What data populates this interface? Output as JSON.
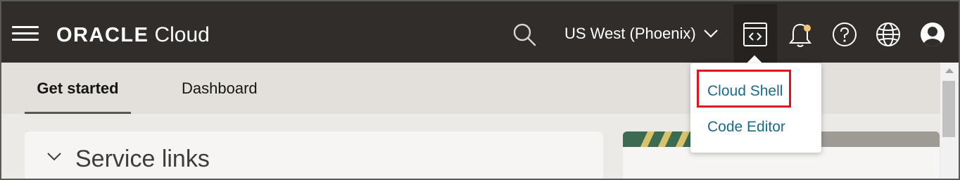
{
  "header": {
    "brand_oracle": "ORACLE",
    "brand_cloud": "Cloud",
    "region": "US West (Phoenix)",
    "icons": [
      "menu-icon",
      "search-icon",
      "chevron-down-icon",
      "code-icon",
      "bell-icon",
      "help-icon",
      "globe-icon",
      "user-icon"
    ],
    "colors": {
      "bar": "#312d2a",
      "active_button": "#252220",
      "notification_dot": "#f5c27a"
    }
  },
  "tabs": [
    {
      "label": "Get started",
      "active": true
    },
    {
      "label": "Dashboard",
      "active": false
    }
  ],
  "content": {
    "section_title": "Service links",
    "section_icon": "chevron-down-icon"
  },
  "dropdown": {
    "items": [
      {
        "label": "Cloud Shell",
        "highlighted": true
      },
      {
        "label": "Code Editor",
        "highlighted": false
      }
    ],
    "link_color": "#1c6a8a",
    "highlight_color": "#e0141e"
  }
}
